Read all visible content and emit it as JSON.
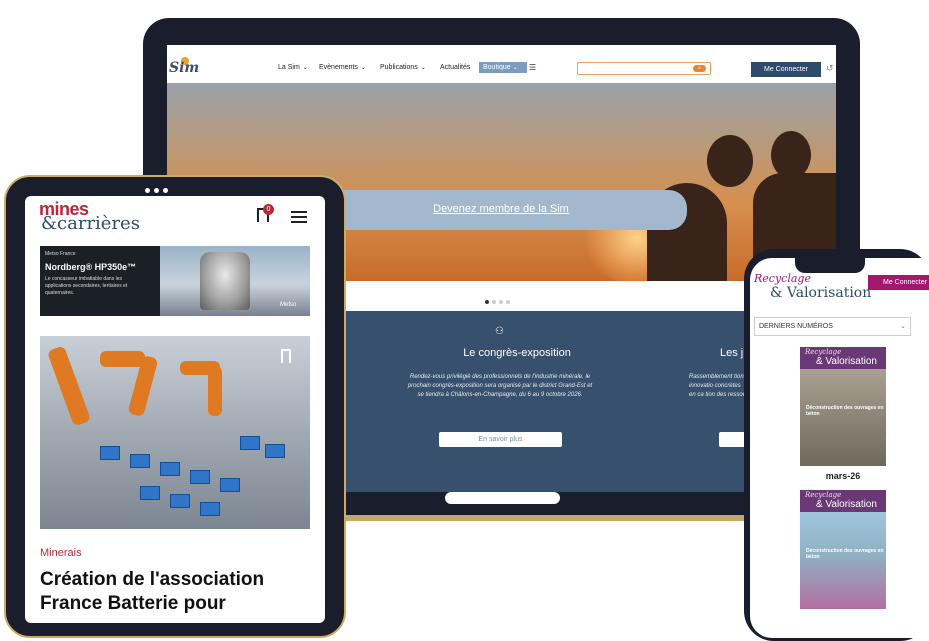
{
  "laptop": {
    "logo": "Sim",
    "nav": [
      {
        "label": "La Sim",
        "chevron": true
      },
      {
        "label": "Evènements",
        "chevron": true
      },
      {
        "label": "Publications",
        "chevron": true
      },
      {
        "label": "Actualités",
        "chevron": false
      }
    ],
    "shop_label": "Boutique",
    "connect_label": "Me Connecter",
    "banner_text": "Devenez membre de la Sim",
    "slider_dots": 4,
    "slider_active_index": 0,
    "section1": {
      "title": "Le congrès-exposition",
      "text": "Rendez-vous privilégié des professionnels de l'industrie minérale, le prochain congrès-exposition sera organisé par le district Grand-Est et se tiendra à Châlons-en-Champagne, du 6 au 9 octobre 2026.",
      "button": "En savoir plus"
    },
    "section2": {
      "title": "Les j",
      "text": "Rassemblement tions, innovatio concrètes en ca tion des ressour"
    },
    "colors": {
      "accent": "#37506d",
      "shop": "#7a9cc0",
      "search_border": "#e8a25a"
    }
  },
  "tablet": {
    "logo_line1": "mines",
    "logo_line2": "&carrières",
    "notification_count": "0",
    "ad": {
      "brand": "Metso France",
      "title": "Nordberg® HP350e™",
      "text": "Le concasseur imbattable dans les applications secondaires, tertiaires et quaternaires.",
      "logo": "Metso"
    },
    "category": "Minerais",
    "article_title": "Création de l'association France Batterie pour",
    "colors": {
      "brand": "#b32a3a",
      "navy": "#2f4a6d"
    }
  },
  "phone": {
    "logo_line1": "Recyclage",
    "logo_line2": "& Valorisation",
    "connect_label": "Me Connecter",
    "select_label": "DERNIERS NUMÉROS",
    "issues": [
      {
        "date": "mars-26",
        "cover_caption": "Déconstruction des ouvrages en béton"
      },
      {
        "date": "",
        "cover_caption": "Déconstruction des ouvrages en béton"
      }
    ],
    "colors": {
      "brand": "#a2186e"
    }
  }
}
